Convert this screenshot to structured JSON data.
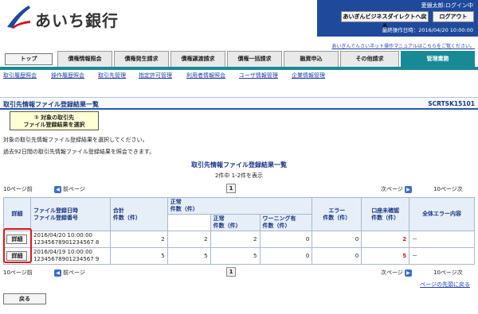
{
  "header": {
    "bank_name": "あいち銀行",
    "user_name": "愛銀太郎:ログイン中",
    "portal_button": "あいぎんビジネスダイレクトへ戻る",
    "logout_button": "ログアウト",
    "last_login": "最終操作日時：2016/04/20 10:00:00",
    "manual_link": "あいぎんでんさいネット操作マニュアルはこちらをご覧ください。"
  },
  "tabs": [
    {
      "label": "トップ"
    },
    {
      "label": "債権情報照会"
    },
    {
      "label": "債権発生請求"
    },
    {
      "label": "債権譲渡請求"
    },
    {
      "label": "債権一括請求"
    },
    {
      "label": "融資申込"
    },
    {
      "label": "その他請求"
    },
    {
      "label": "管理業務"
    }
  ],
  "subnav": [
    {
      "label": "取引履歴照会"
    },
    {
      "label": "操作履歴照会"
    },
    {
      "label": "取引先管理"
    },
    {
      "label": "指定許可管理"
    },
    {
      "label": "利用者情報照会"
    },
    {
      "label": "ユーザ情報管理"
    },
    {
      "label": "企業情報管理"
    }
  ],
  "page": {
    "title": "取引先情報ファイル登録結果一覧",
    "screen_id": "SCRTSK15101",
    "step_line1": "① 対象の取引先",
    "step_line2": "ファイル登録結果を選択",
    "instruction1": "対象の取引先情報ファイル登録結果を選択してください。",
    "instruction2": "過去92日間の取引先情報ファイル登録結果を照会できます。",
    "list_title": "取引先情報ファイル登録結果一覧",
    "count_text": "2件中 1-2件を表示"
  },
  "pager": {
    "prev10": "10ページ前",
    "prev": "前ページ",
    "page": "1",
    "next": "次ページ",
    "next10": "10ページ次"
  },
  "table": {
    "headers": {
      "detail": "詳細",
      "file_reg_line1": "ファイル登録日時",
      "file_reg_line2": "ファイル登録番号",
      "total": "合計\n件数（件）",
      "normal": "正常\n件数（件）",
      "normal_sub": "正常\n件数（件）",
      "warning_sub": "ワーニング有\n件数（件）",
      "error": "エラー\n件数（件）",
      "unconfirmed": "口座未確認\n件数（件）",
      "all_error": "全体エラー内容"
    },
    "rows": [
      {
        "detail": "詳細",
        "date": "2016/04/20 10:00:00",
        "number": "12345678901234567 8",
        "total": "2",
        "normal": "2",
        "normal_sub": "2",
        "warning": "0",
        "error": "0",
        "unconfirmed": "2",
        "all_error": "－"
      },
      {
        "detail": "詳細",
        "date": "2016/04/19 10:00:00",
        "number": "12345678901234567 9",
        "total": "5",
        "normal": "5",
        "normal_sub": "5",
        "warning": "0",
        "error": "0",
        "unconfirmed": "5",
        "all_error": "－"
      }
    ]
  },
  "footer": {
    "back_to_top": "ページの先頭に戻る",
    "back_button": "戻る"
  }
}
